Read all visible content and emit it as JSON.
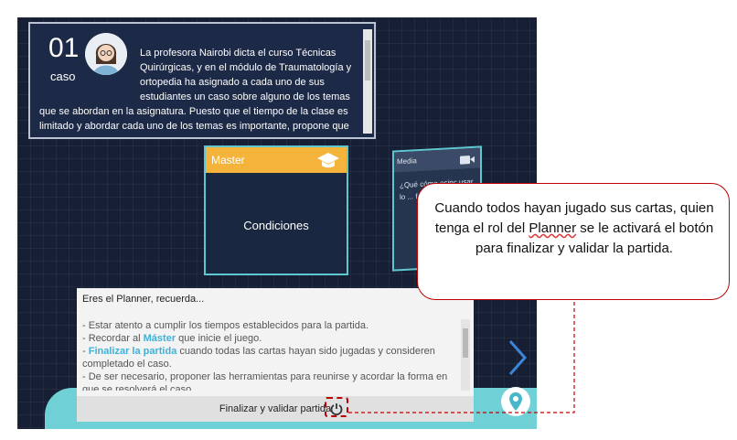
{
  "case_card": {
    "number": "01",
    "word": "caso",
    "text": "La profesora Nairobi dicta el curso Técnicas Quirúrgicas, y en el módulo de Traumatología y ortopedia ha asignado a cada uno de sus estudiantes un caso sobre alguno de los temas que se abordan en la asignatura. Puesto que el tiempo de la clase es limitado y abordar cada uno de los temas es importante, propone que previo al encuentro"
  },
  "cards": {
    "master_title": "Master",
    "master_body": "Condiciones",
    "media_title": "Media",
    "media_body": "¿Qué cómo asinc usar lo ... facilit ciona"
  },
  "planner": {
    "title": "Eres el Planner, recuerda...",
    "line1": "- Estar atento a cumplir los tiempos establecidos para la partida.",
    "line2_prefix": "- Recordar al ",
    "line2_highlight": "Máster",
    "line2_suffix": " que inicie el juego.",
    "line3_prefix": "- ",
    "line3_highlight": "Finalizar la partida",
    "line3_suffix": " cuando todas las cartas hayan sido jugadas y consideren completado el caso.",
    "line4": "- De ser necesario, proponer las herramientas para reunirse y acordar la forma en que se resolverá el caso.",
    "finalize_label": "Finalizar y validar partida"
  },
  "callout": {
    "text_before": "Cuando todos hayan jugado sus cartas, quien tenga el rol del ",
    "text_underlined": "Planner",
    "text_after": " se le activará el botón para finalizar y validar la partida."
  },
  "icons": {
    "graduation": "graduation-cap-icon",
    "camera": "video-camera-icon",
    "next": "chevron-right-icon",
    "map": "location-pin-icon",
    "power": "power-icon"
  },
  "colors": {
    "background": "#161f33",
    "master_header": "#f4b33a",
    "accent_teal": "#6fd1d6",
    "highlight_blue": "#3fb1d9",
    "annotation_red": "#c00000"
  }
}
